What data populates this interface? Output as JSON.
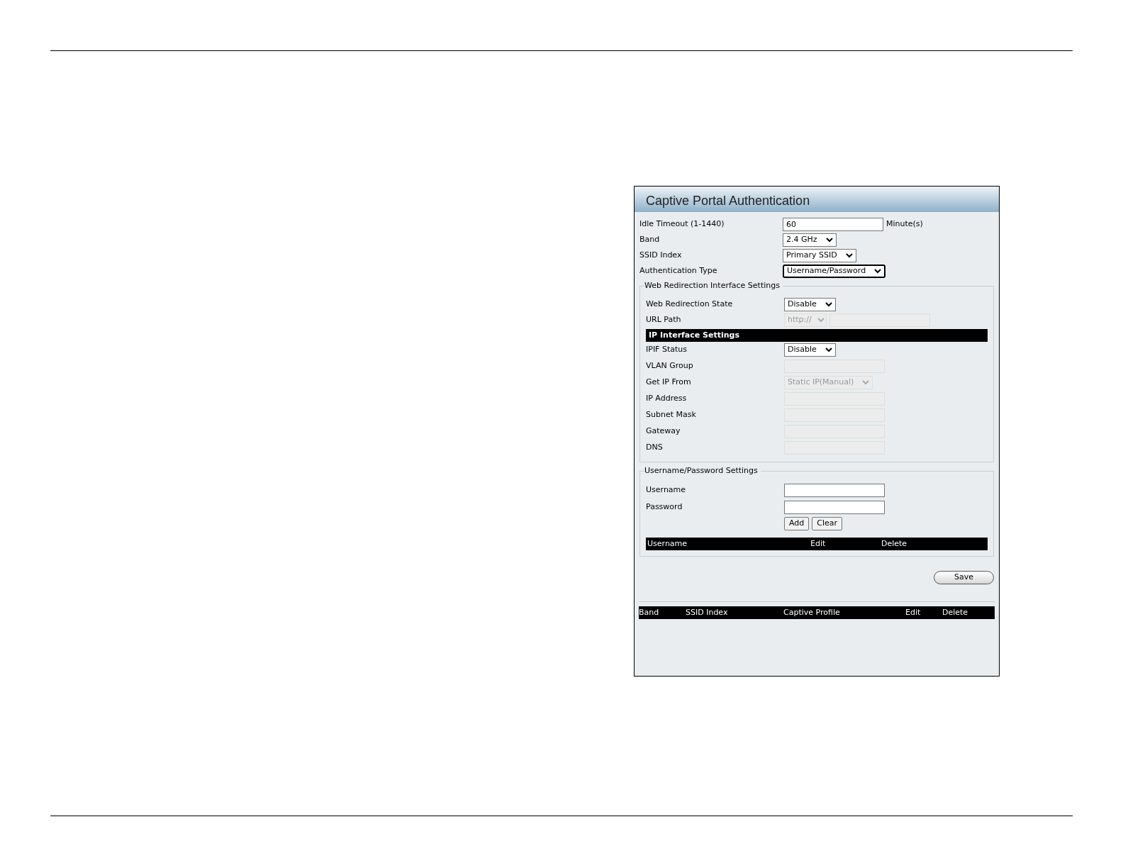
{
  "panel": {
    "title": "Captive Portal Authentication",
    "fields": [
      {
        "label": "Idle Timeout (1-1440)",
        "kind": "text",
        "value": "60",
        "unit": "Minute(s)",
        "disabled": false,
        "focused": false
      },
      {
        "label": "Band",
        "kind": "select",
        "value": "2.4 GHz",
        "disabled": false,
        "focused": false
      },
      {
        "label": "SSID Index",
        "kind": "select",
        "value": "Primary SSID",
        "disabled": false,
        "focused": false
      },
      {
        "label": "Authentication Type",
        "kind": "select",
        "value": "Username/Password",
        "disabled": false,
        "focused": true
      }
    ],
    "web_redirection": {
      "legend": "Web Redirection Interface Settings",
      "fields": [
        {
          "label": "Web Redirection State",
          "kind": "select",
          "value": "Disable",
          "disabled": false
        },
        {
          "label": "URL Path",
          "kind": "url",
          "value": "http://",
          "disabled": true
        }
      ]
    },
    "ip_interface": {
      "heading": "IP Interface Settings",
      "fields": [
        {
          "label": "IPIF Status",
          "kind": "select",
          "value": "Disable",
          "disabled": false
        },
        {
          "label": "VLAN Group",
          "kind": "text",
          "disabled": true
        },
        {
          "label": "Get IP From",
          "kind": "select",
          "value": "Static IP(Manual)",
          "disabled": true
        },
        {
          "label": "IP Address",
          "kind": "text",
          "disabled": true
        },
        {
          "label": "Subnet Mask",
          "kind": "text",
          "disabled": true
        },
        {
          "label": "Gateway",
          "kind": "text",
          "disabled": true
        },
        {
          "label": "DNS",
          "kind": "text",
          "disabled": true
        }
      ]
    },
    "user_settings": {
      "legend": "Username/Password Settings",
      "fields": [
        {
          "label": "Username",
          "kind": "text",
          "disabled": false
        },
        {
          "label": "Password",
          "kind": "text",
          "disabled": false
        }
      ],
      "buttons": [
        "Add",
        "Clear"
      ],
      "table_columns": [
        "Username",
        "Edit",
        "Delete"
      ]
    },
    "save_button": "Save",
    "profile_table": {
      "columns": [
        "Band",
        "SSID Index",
        "Captive Profile",
        "Edit",
        "Delete"
      ]
    }
  }
}
